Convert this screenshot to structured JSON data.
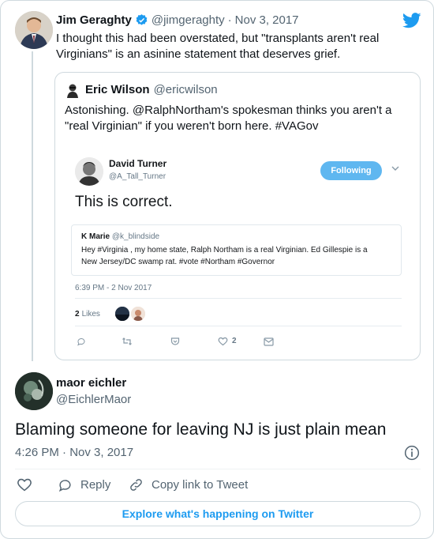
{
  "main_tweet": {
    "author_name": "Jim Geraghty",
    "author_handle": "@jimgeraghty",
    "separator": "·",
    "date": "Nov 3, 2017",
    "text_line1": "I thought this had been overstated, but \"transplants aren't real",
    "text_line2": "Virginians\" is an asinine statement that deserves grief."
  },
  "quoted_tweet": {
    "author_name": "Eric Wilson",
    "author_handle": "@ericwilson",
    "text_line1": "Astonishing. @RalphNortham's spokesman thinks you aren't a",
    "text_line2": "\"real Virginian\" if you weren't born here. #VAGov",
    "screenshot": {
      "author_name": "David Turner",
      "author_handle": "@A_Tall_Turner",
      "follow_label": "Following",
      "text": "This is correct.",
      "inner_author_name": "K Marie",
      "inner_author_handle": "@k_blindside",
      "inner_text_line1": "Hey #Virginia , my home state, Ralph Northam is a real Virginian. Ed Gillespie is a",
      "inner_text_line2": "New Jersey/DC swamp rat. #vote #Northam #Governor",
      "timestamp": "6:39 PM - 2 Nov 2017",
      "likes_count": "2",
      "likes_label": "Likes",
      "like_action_count": "2"
    }
  },
  "reply_tweet": {
    "author_name": "maor eichler",
    "author_handle": "@EichlerMaor",
    "text": "Blaming someone for leaving NJ is just plain mean",
    "timestamp": "4:26 PM · Nov 3, 2017"
  },
  "actions": {
    "reply_label": "Reply",
    "copy_link_label": "Copy link to Tweet"
  },
  "explore_label": "Explore what's happening on Twitter",
  "colors": {
    "brand_blue": "#1d9bf0",
    "verified_blue": "#1d9bf0",
    "follow_button": "#5fb7f0",
    "secondary_text": "#536471",
    "border": "#cfd9de"
  },
  "icons": [
    "twitter-logo-icon",
    "verified-badge-icon",
    "chevron-down-icon",
    "info-icon",
    "heart-icon",
    "reply-icon",
    "link-icon",
    "retweet-icon",
    "pocket-icon",
    "mail-icon"
  ]
}
